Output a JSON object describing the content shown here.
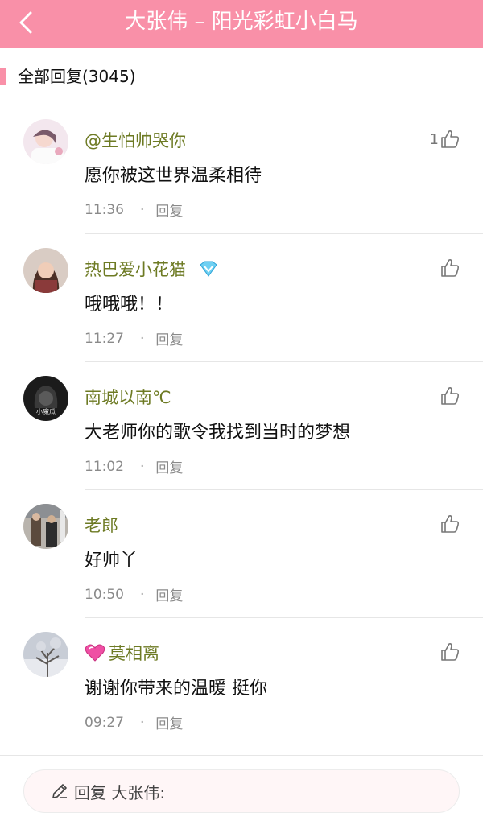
{
  "header": {
    "title": "大张伟 – 阳光彩虹小白马"
  },
  "section": {
    "label": "全部回复(3045)"
  },
  "comments": [
    {
      "name": "@生怕帅哭你",
      "content": "愿你被这世界温柔相待",
      "time": "11:36",
      "reply": "回复",
      "likes": "1",
      "badge": "",
      "avatar": "girl-avatar"
    },
    {
      "name": "热巴爱小花猫",
      "content": "哦哦哦！！",
      "time": "11:27",
      "reply": "回复",
      "likes": "",
      "badge": "vip-diamond-icon",
      "avatar": "girl-photo-avatar"
    },
    {
      "name": "南城以南℃",
      "content": "大老师你的歌令我找到当时的梦想",
      "time": "11:02",
      "reply": "回复",
      "likes": "",
      "badge": "",
      "avatar": "dark-hood-avatar",
      "avatar_text": "小魔瓜"
    },
    {
      "name": "老郎",
      "content": "好帅丫",
      "time": "10:50",
      "reply": "回复",
      "likes": "",
      "badge": "",
      "avatar": "street-photo-avatar"
    },
    {
      "name": "莫相离",
      "content": "谢谢你带来的温暖  挺你",
      "time": "09:27",
      "reply": "回复",
      "likes": "",
      "badge": "heart-icon",
      "avatar": "winter-tree-avatar"
    }
  ],
  "reply_bar": {
    "text": "回复 大张伟:"
  },
  "colors": {
    "accent": "#f990a8",
    "username": "#6d7a23",
    "meta": "#8a8a8a"
  },
  "icons": {
    "back": "chevron-left-icon",
    "like": "thumbs-up-icon",
    "compose": "pencil-icon"
  }
}
